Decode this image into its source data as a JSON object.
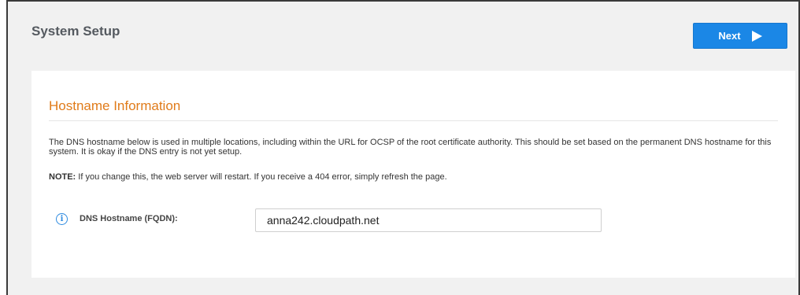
{
  "header": {
    "title": "System Setup",
    "next_label": "Next",
    "next_icon": "play-triangle-icon",
    "accent_color": "#1b87e6"
  },
  "section": {
    "title": "Hostname Information",
    "title_color": "#e07b1a",
    "description": "The DNS hostname below is used in multiple locations, including within the URL for OCSP of the root certificate authority. This should be set based on the permanent DNS hostname for this system. It is okay if the DNS entry is not yet setup.",
    "note_prefix": "NOTE:",
    "note_text": " If you change this, the web server will restart. If you receive a 404 error, simply refresh the page."
  },
  "field": {
    "info_icon": "info-circle-icon",
    "label": "DNS Hostname (FQDN):",
    "value": "anna242.cloudpath.net"
  }
}
